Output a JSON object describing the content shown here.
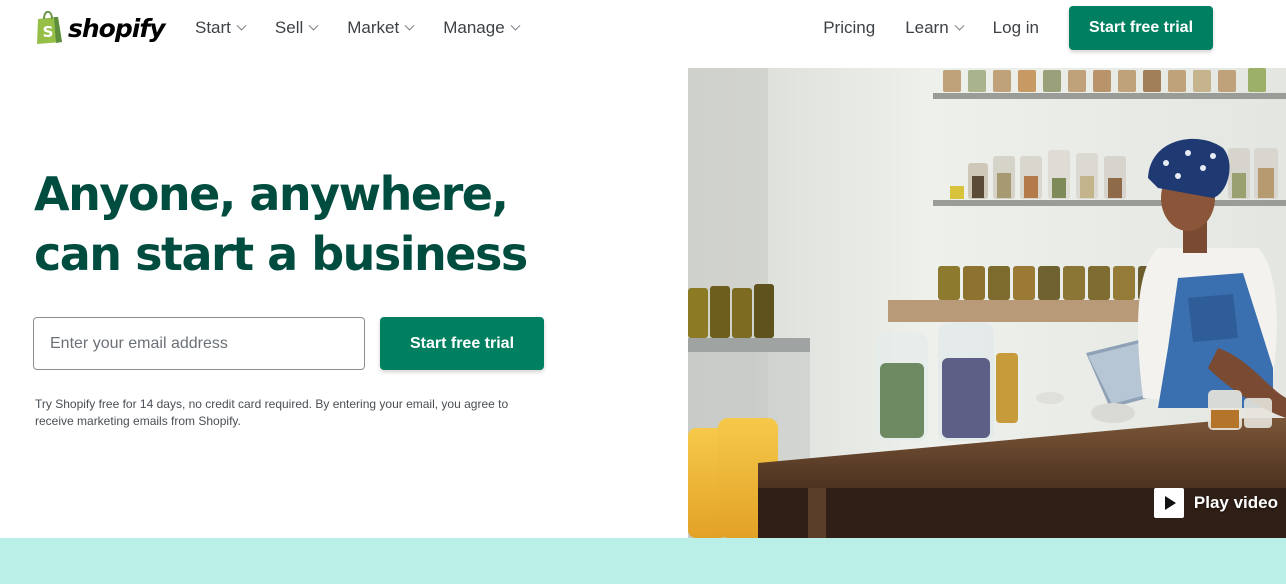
{
  "brand": {
    "name": "shopify",
    "logo_icon": "shopping-bag-icon",
    "logo_color": "#95bf47"
  },
  "nav": {
    "left": [
      {
        "label": "Start",
        "has_dropdown": true
      },
      {
        "label": "Sell",
        "has_dropdown": true
      },
      {
        "label": "Market",
        "has_dropdown": true
      },
      {
        "label": "Manage",
        "has_dropdown": true
      }
    ],
    "right": [
      {
        "label": "Pricing",
        "has_dropdown": false
      },
      {
        "label": "Learn",
        "has_dropdown": true
      },
      {
        "label": "Log in",
        "has_dropdown": false
      }
    ],
    "cta_label": "Start free trial"
  },
  "hero": {
    "title_line1": "Anyone, anywhere,",
    "title_line2": "can start a business",
    "email_placeholder": "Enter your email address",
    "email_value": "",
    "cta_label": "Start free trial",
    "disclaimer": "Try Shopify free for 14 days, no credit card required. By entering your email, you agree to receive marketing emails from Shopify.",
    "play_video_label": "Play video"
  },
  "colors": {
    "primary": "#008060",
    "headline": "#004c3f",
    "bottom_strip": "#b9efe6"
  }
}
